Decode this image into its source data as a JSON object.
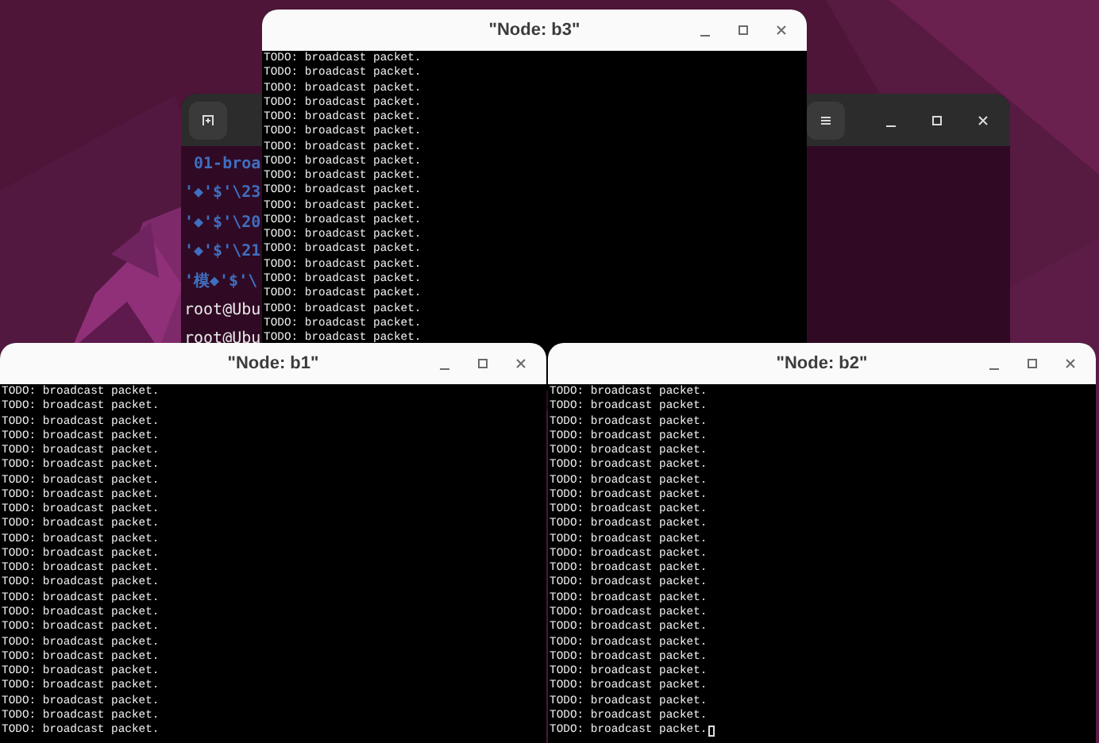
{
  "background_terminal": {
    "lines": [
      {
        "kind": "listing",
        "text": " 01-broa"
      },
      {
        "kind": "listing",
        "text": "'◆'$'\\23"
      },
      {
        "kind": "listing",
        "text": "'◆'$'\\20"
      },
      {
        "kind": "listing",
        "text": "'◆'$'\\21"
      },
      {
        "kind": "listing",
        "text": "'模◆'$'\\"
      },
      {
        "kind": "prompt",
        "text": "root@Ubu"
      },
      {
        "kind": "prompt",
        "text": "root@Ubu"
      }
    ]
  },
  "windows": [
    {
      "title": "\"Node: b3\"",
      "cursor": false,
      "lines": [
        "TODO: broadcast packet.",
        "TODO: broadcast packet.",
        "TODO: broadcast packet.",
        "TODO: broadcast packet.",
        "TODO: broadcast packet.",
        "TODO: broadcast packet.",
        "TODO: broadcast packet.",
        "TODO: broadcast packet.",
        "TODO: broadcast packet.",
        "TODO: broadcast packet.",
        "TODO: broadcast packet.",
        "TODO: broadcast packet.",
        "TODO: broadcast packet.",
        "TODO: broadcast packet.",
        "TODO: broadcast packet.",
        "TODO: broadcast packet.",
        "TODO: broadcast packet.",
        "TODO: broadcast packet.",
        "TODO: broadcast packet.",
        "TODO: broadcast packet."
      ]
    },
    {
      "title": "\"Node: b1\"",
      "cursor": false,
      "lines": [
        "TODO: broadcast packet.",
        "TODO: broadcast packet.",
        "TODO: broadcast packet.",
        "TODO: broadcast packet.",
        "TODO: broadcast packet.",
        "TODO: broadcast packet.",
        "TODO: broadcast packet.",
        "TODO: broadcast packet.",
        "TODO: broadcast packet.",
        "TODO: broadcast packet.",
        "TODO: broadcast packet.",
        "TODO: broadcast packet.",
        "TODO: broadcast packet.",
        "TODO: broadcast packet.",
        "TODO: broadcast packet.",
        "TODO: broadcast packet.",
        "TODO: broadcast packet.",
        "TODO: broadcast packet.",
        "TODO: broadcast packet.",
        "TODO: broadcast packet.",
        "TODO: broadcast packet.",
        "TODO: broadcast packet.",
        "TODO: broadcast packet.",
        "TODO: broadcast packet."
      ]
    },
    {
      "title": "\"Node: b2\"",
      "cursor": true,
      "lines": [
        "TODO: broadcast packet.",
        "TODO: broadcast packet.",
        "TODO: broadcast packet.",
        "TODO: broadcast packet.",
        "TODO: broadcast packet.",
        "TODO: broadcast packet.",
        "TODO: broadcast packet.",
        "TODO: broadcast packet.",
        "TODO: broadcast packet.",
        "TODO: broadcast packet.",
        "TODO: broadcast packet.",
        "TODO: broadcast packet.",
        "TODO: broadcast packet.",
        "TODO: broadcast packet.",
        "TODO: broadcast packet.",
        "TODO: broadcast packet.",
        "TODO: broadcast packet.",
        "TODO: broadcast packet.",
        "TODO: broadcast packet.",
        "TODO: broadcast packet.",
        "TODO: broadcast packet.",
        "TODO: broadcast packet.",
        "TODO: broadcast packet.",
        "TODO: broadcast packet."
      ]
    }
  ]
}
